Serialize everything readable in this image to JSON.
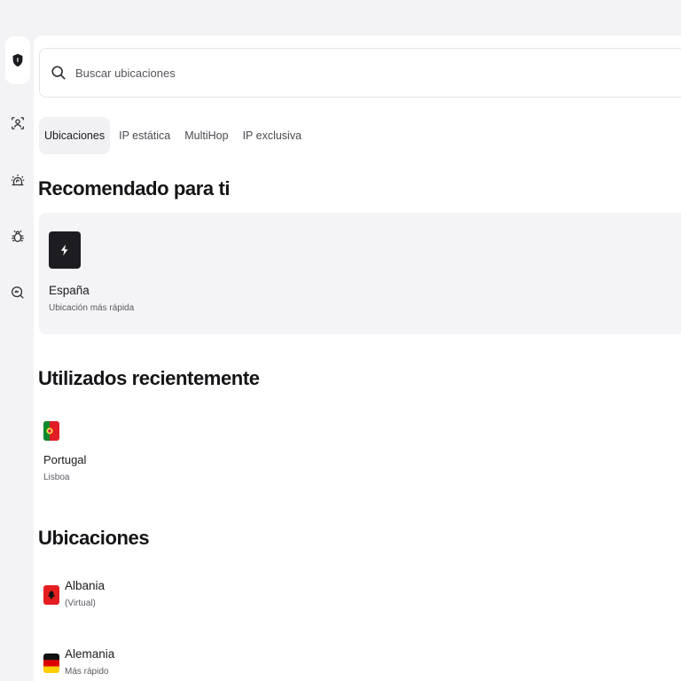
{
  "colors": {
    "accent": "#1d1d21",
    "sidebar_bg": "#f3f3f5",
    "card_bg": "#f4f4f6"
  },
  "sidebar": {
    "items": [
      {
        "icon": "shield-icon",
        "active": true
      },
      {
        "icon": "face-scan-icon",
        "active": false
      },
      {
        "icon": "alarm-icon",
        "active": false
      },
      {
        "icon": "bug-icon",
        "active": false
      },
      {
        "icon": "search-scan-icon",
        "active": false
      }
    ]
  },
  "search": {
    "placeholder": "Buscar ubicaciones",
    "value": ""
  },
  "tabs": [
    {
      "label": "Ubicaciones",
      "active": true
    },
    {
      "label": "IP estática",
      "active": false
    },
    {
      "label": "MultiHop",
      "active": false
    },
    {
      "label": "IP exclusiva",
      "active": false
    }
  ],
  "recommended": {
    "heading": "Recomendado para ti",
    "icon": "lightning-icon",
    "title": "España",
    "subtitle": "Ubicación más rápida"
  },
  "recent": {
    "heading": "Utilizados recientemente",
    "items": [
      {
        "flag": "portugal-flag-icon",
        "name": "Portugal",
        "city": "Lisboa"
      }
    ]
  },
  "locations": {
    "heading": "Ubicaciones",
    "items": [
      {
        "flag": "albania-flag-icon",
        "name": "Albania",
        "sub": "(Virtual)"
      },
      {
        "flag": "germany-flag-icon",
        "name": "Alemania",
        "sub": "Más rápido"
      }
    ]
  }
}
